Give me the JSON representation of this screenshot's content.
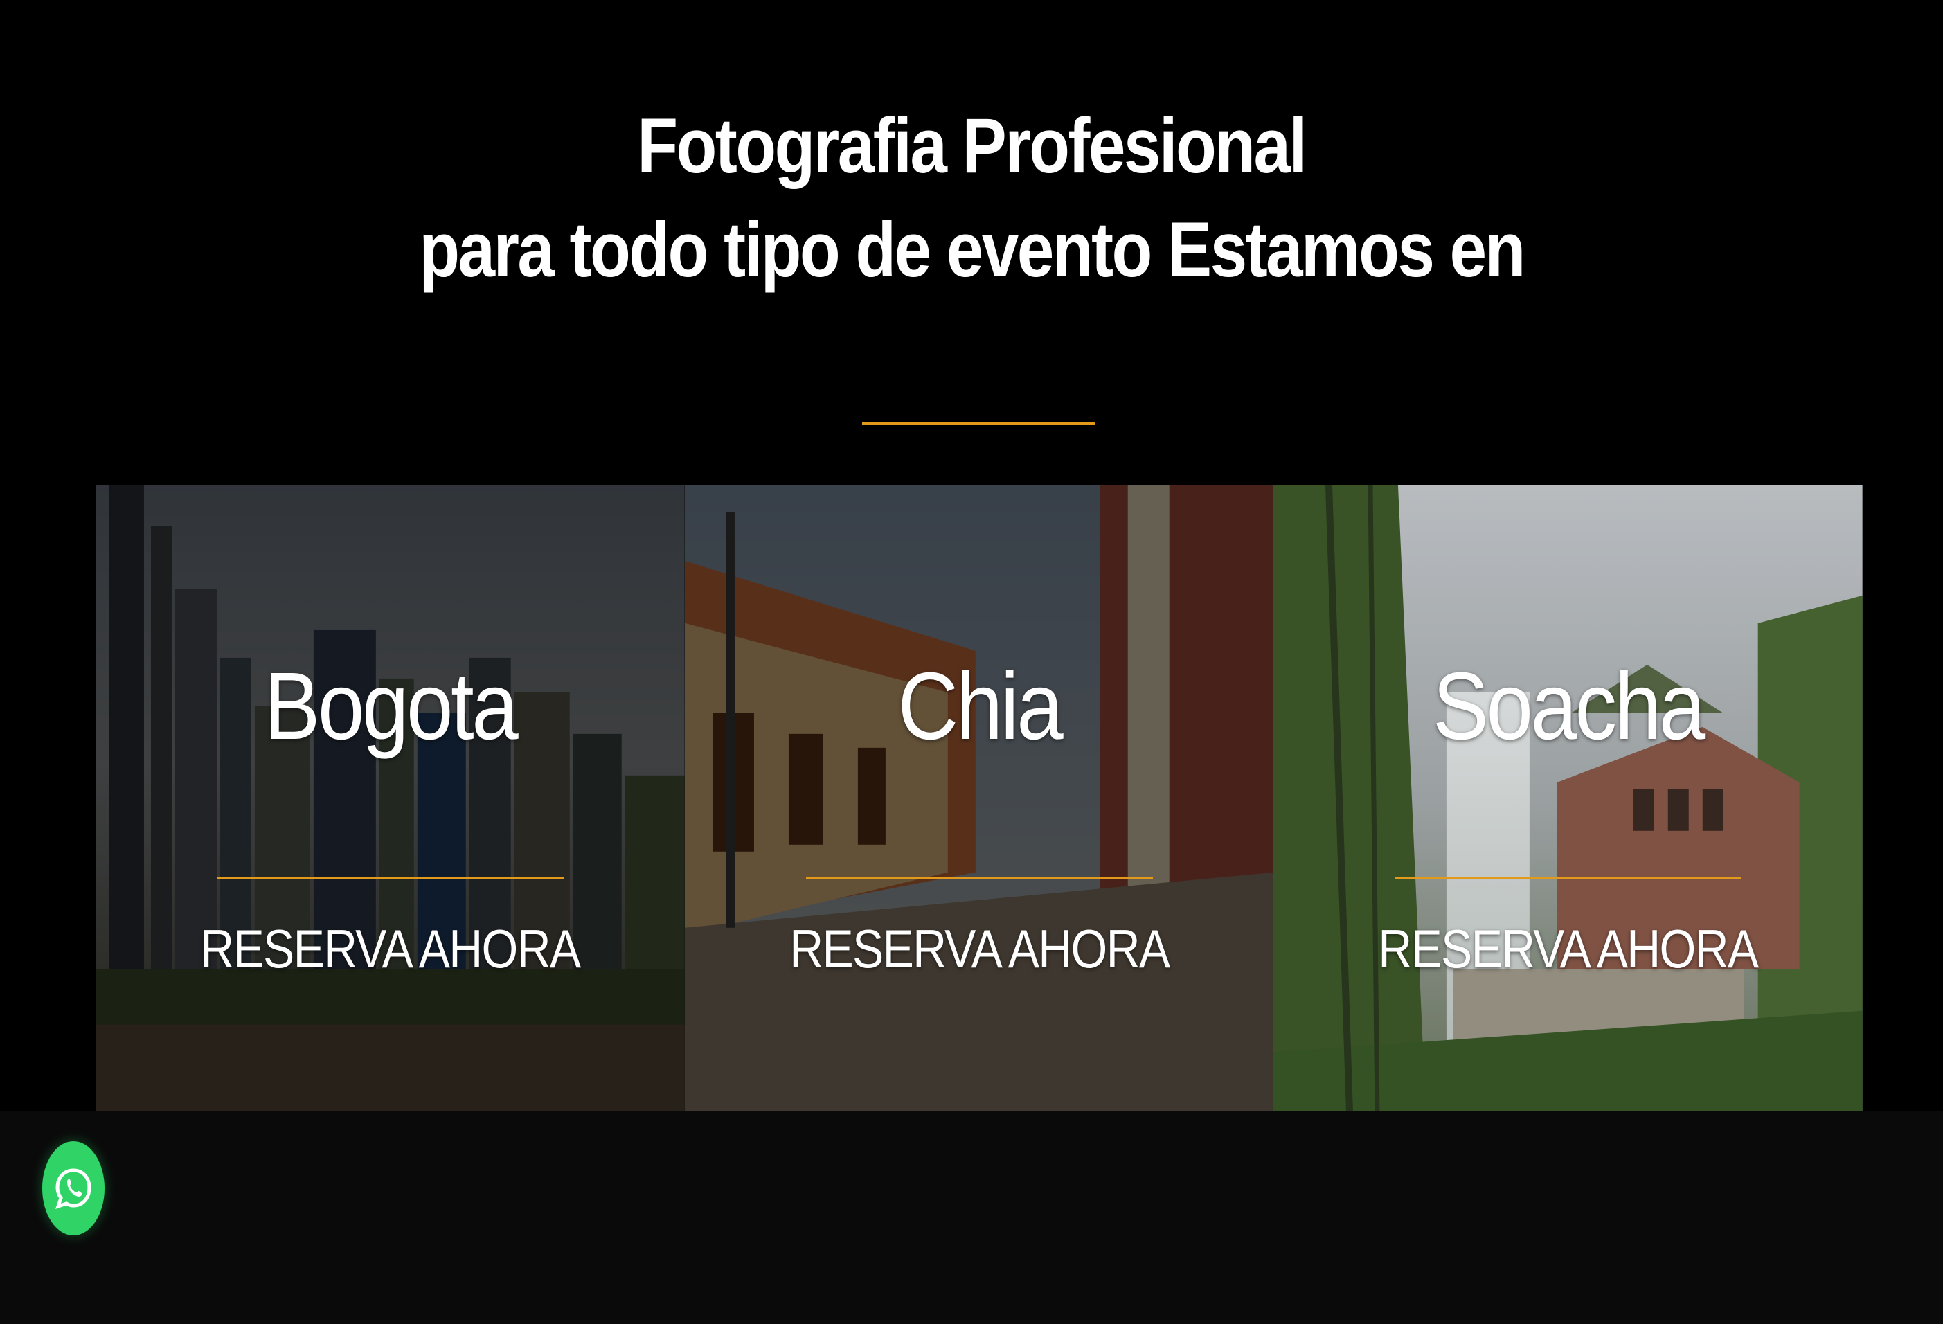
{
  "header": {
    "title_line1": "Fotografia Profesional",
    "title_line2": "para todo tipo de evento Estamos en"
  },
  "locations": [
    {
      "name": "Bogota",
      "cta": "RESERVA AHORA",
      "image": "city-skyline-photo"
    },
    {
      "name": "Chia",
      "cta": "RESERVA AHORA",
      "image": "colonial-street-photo"
    },
    {
      "name": "Soacha",
      "cta": "RESERVA AHORA",
      "image": "waterfall-mansion-photo"
    }
  ],
  "floating": {
    "whatsapp_icon": "whatsapp-icon"
  },
  "colors": {
    "background": "#000000",
    "accent": "#e39a1a",
    "whatsapp": "#2fd366",
    "text": "#ffffff"
  }
}
